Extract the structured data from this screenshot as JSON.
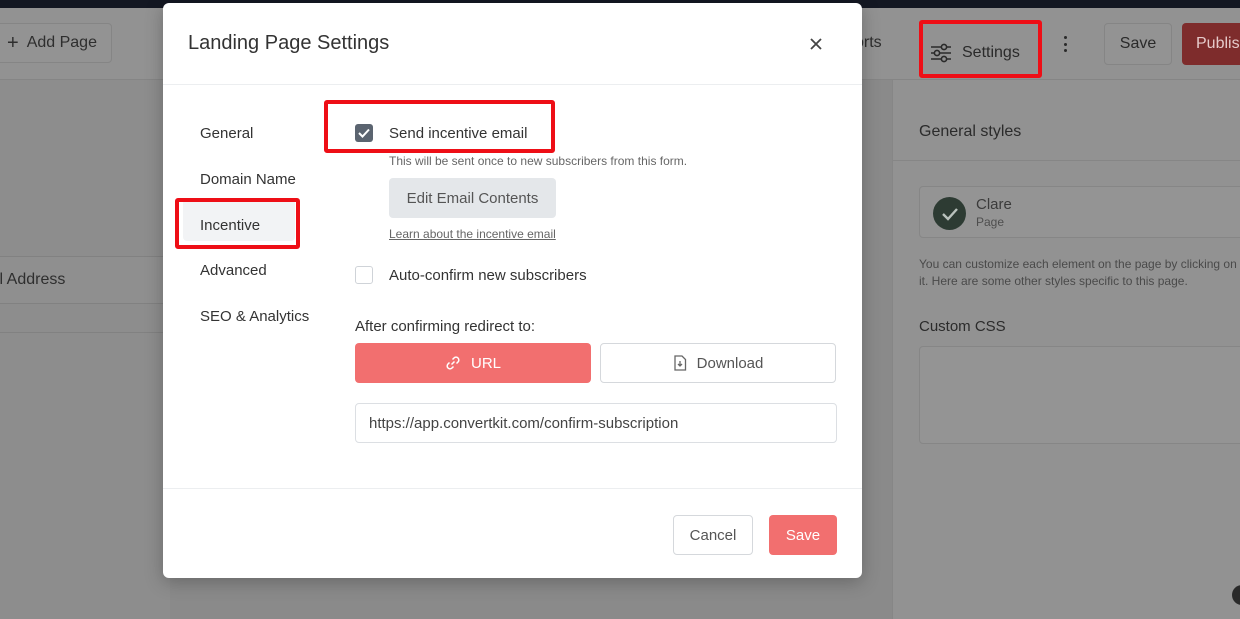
{
  "background": {
    "toolbar": {
      "add_page_label": "Add Page",
      "reports_label": "orts",
      "settings_label": "Settings",
      "save_label": "Save",
      "publish_label": "Publis"
    },
    "left_panel": {
      "field_label": "il Address"
    },
    "right_panel": {
      "title": "General styles",
      "template_name": "Clare",
      "template_type": "Page",
      "description": "You can customize each element on the page by clicking on it. Here are some other styles specific to this page.",
      "custom_css_label": "Custom CSS"
    }
  },
  "modal": {
    "title": "Landing Page Settings",
    "nav": [
      {
        "label": "General"
      },
      {
        "label": "Domain Name"
      },
      {
        "label": "Incentive"
      },
      {
        "label": "Advanced"
      },
      {
        "label": "SEO & Analytics"
      }
    ],
    "active_nav": "Incentive",
    "incentive": {
      "send_email_label": "Send incentive email",
      "send_email_checked": true,
      "send_email_hint": "This will be sent once to new subscribers from this form.",
      "edit_email_button": "Edit Email Contents",
      "learn_link": "Learn about the incentive email",
      "auto_confirm_label": "Auto-confirm new subscribers",
      "auto_confirm_checked": false,
      "redirect_label": "After confirming redirect to:",
      "redirect_options": [
        "URL",
        "Download"
      ],
      "redirect_selected": "URL",
      "redirect_url": "https://app.convertkit.com/confirm-subscription"
    },
    "footer": {
      "cancel_label": "Cancel",
      "save_label": "Save"
    }
  },
  "colors": {
    "accent": "#f26f6f",
    "highlight": "#ee0e16",
    "checkbox_checked": "#5b6470"
  }
}
